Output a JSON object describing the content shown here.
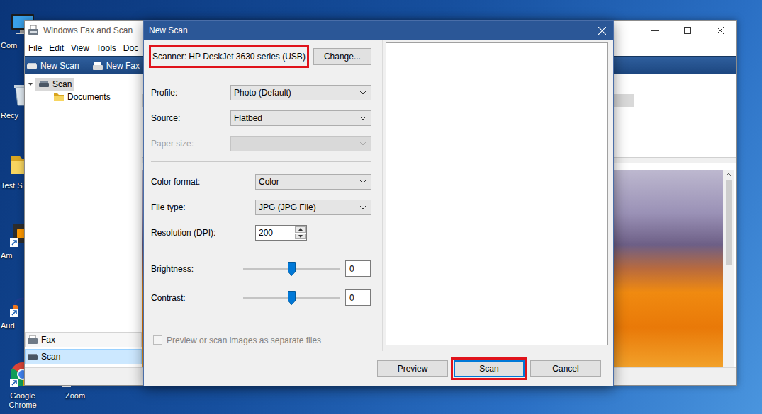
{
  "desktop": {
    "icons": [
      {
        "label": "Com"
      },
      {
        "label": "Recy"
      },
      {
        "label": "Test S"
      },
      {
        "label": "Am"
      },
      {
        "label": "Aud"
      },
      {
        "label": "Google Chrome"
      },
      {
        "label": "Zoom"
      }
    ]
  },
  "back_window": {
    "title": "Windows Fax and Scan",
    "menu": [
      "File",
      "Edit",
      "View",
      "Tools",
      "Doc"
    ],
    "toolbar": [
      "New Scan",
      "New Fax"
    ],
    "tree": {
      "label": "Scan",
      "expanded": true,
      "selected": true,
      "children": [
        {
          "label": "Documents",
          "selected": false
        }
      ]
    },
    "nav": [
      {
        "label": "Fax",
        "selected": false
      },
      {
        "label": "Scan",
        "selected": true
      }
    ],
    "documents": [
      {
        "selected": true
      }
    ]
  },
  "dialog": {
    "title": "New Scan",
    "scanner": {
      "label": "Scanner: HP DeskJet 3630 series (USB)",
      "highlighted": true
    },
    "change_button": "Change...",
    "sections": [
      [
        {
          "kind": "select",
          "label": "Profile:",
          "value": "Photo (Default)",
          "disabled": false
        },
        {
          "kind": "select",
          "label": "Source:",
          "value": "Flatbed",
          "disabled": false
        },
        {
          "kind": "select",
          "label": "Paper size:",
          "value": "",
          "disabled": true
        }
      ],
      [
        {
          "kind": "select",
          "label": "Color format:",
          "value": "Color",
          "disabled": false
        },
        {
          "kind": "select",
          "label": "File type:",
          "value": "JPG (JPG File)",
          "disabled": false
        },
        {
          "kind": "spinner",
          "label": "Resolution (DPI):",
          "value": "200",
          "disabled": false
        }
      ]
    ],
    "sliders": [
      {
        "label": "Brightness:",
        "level": 0.5,
        "value": "0"
      },
      {
        "label": "Contrast:",
        "level": 0.5,
        "value": "0"
      }
    ],
    "checkbox": {
      "label": "Preview or scan images as separate files",
      "checked": false,
      "disabled": true
    },
    "buttons": [
      {
        "label": "Preview",
        "default": false,
        "highlighted": false
      },
      {
        "label": "Scan",
        "default": true,
        "highlighted": true
      },
      {
        "label": "Cancel",
        "default": false,
        "highlighted": false
      }
    ]
  }
}
